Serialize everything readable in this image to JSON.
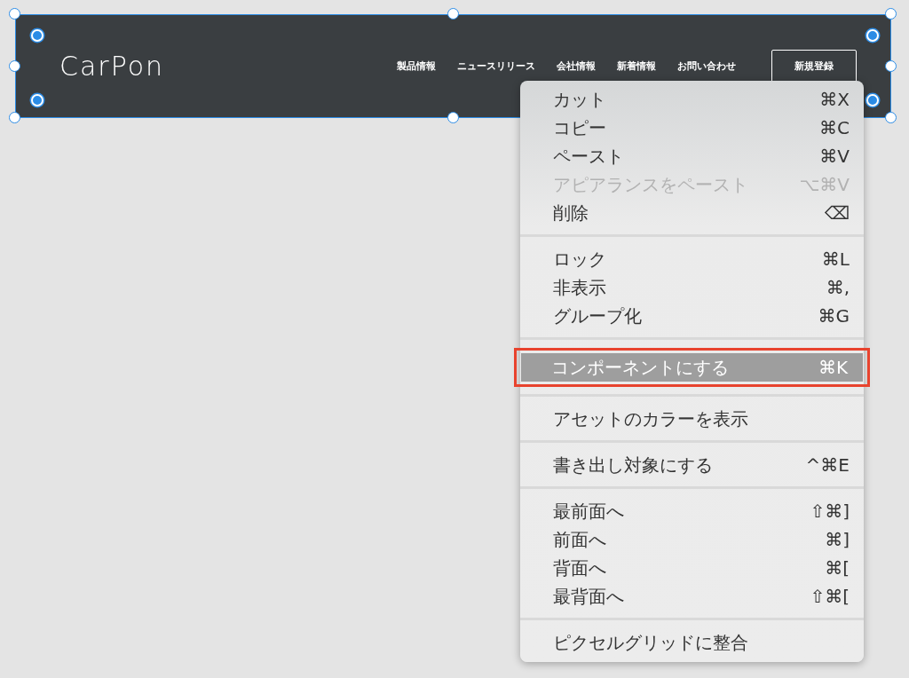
{
  "header": {
    "logo": "CarPon",
    "nav": [
      "製品情報",
      "ニュースリリース",
      "会社情報",
      "新着情報",
      "お問い合わせ"
    ],
    "button": "新規登録",
    "selected": true
  },
  "context_menu": {
    "groups": [
      [
        {
          "label": "カット",
          "shortcut": "⌘X",
          "disabled": false,
          "selected": false,
          "outlined": false
        },
        {
          "label": "コピー",
          "shortcut": "⌘C",
          "disabled": false,
          "selected": false,
          "outlined": false
        },
        {
          "label": "ペースト",
          "shortcut": "⌘V",
          "disabled": false,
          "selected": false,
          "outlined": false
        },
        {
          "label": "アピアランスをペースト",
          "shortcut": "⌥⌘V",
          "disabled": true,
          "selected": false,
          "outlined": false
        },
        {
          "label": "削除",
          "shortcut": "⌫",
          "disabled": false,
          "selected": false,
          "outlined": false
        }
      ],
      [
        {
          "label": "ロック",
          "shortcut": "⌘L",
          "disabled": false,
          "selected": false,
          "outlined": false
        },
        {
          "label": "非表示",
          "shortcut": "⌘,",
          "disabled": false,
          "selected": false,
          "outlined": false
        },
        {
          "label": "グループ化",
          "shortcut": "⌘G",
          "disabled": false,
          "selected": false,
          "outlined": false
        }
      ],
      [
        {
          "label": "コンポーネントにする",
          "shortcut": "⌘K",
          "disabled": false,
          "selected": true,
          "outlined": true
        }
      ],
      [
        {
          "label": "アセットのカラーを表示",
          "disabled": false,
          "selected": false,
          "outlined": false
        }
      ],
      [
        {
          "label": "書き出し対象にする",
          "shortcut": "^⌘E",
          "disabled": false,
          "selected": false,
          "outlined": false
        }
      ],
      [
        {
          "label": "最前面へ",
          "shortcut": "⇧⌘]",
          "disabled": false,
          "selected": false,
          "outlined": false
        },
        {
          "label": "前面へ",
          "shortcut": "⌘]",
          "disabled": false,
          "selected": false,
          "outlined": false
        },
        {
          "label": "背面へ",
          "shortcut": "⌘[",
          "disabled": false,
          "selected": false,
          "outlined": false
        },
        {
          "label": "最背面へ",
          "shortcut": "⇧⌘[",
          "disabled": false,
          "selected": false,
          "outlined": false
        }
      ],
      [
        {
          "label": "ピクセルグリッドに整合",
          "disabled": false,
          "selected": false,
          "outlined": false
        }
      ]
    ]
  }
}
